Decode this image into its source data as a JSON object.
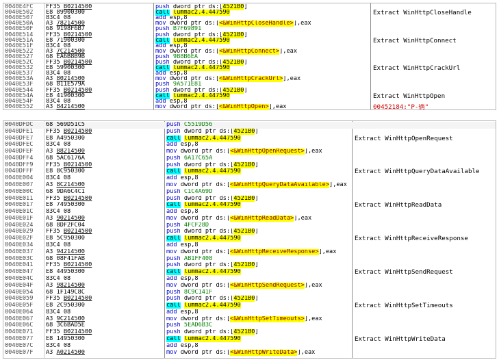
{
  "panel1": {
    "rows": [
      {
        "addr": "0040E4FC",
        "bytes": "FF35 B0214500",
        "bu": "B0214500",
        "mn": "push",
        "op": [
          {
            "t": "dword ptr ds:[",
            "c": "plain"
          },
          {
            "t": "4521B0",
            "c": "tgt"
          },
          {
            "t": "]",
            "c": "plain"
          }
        ]
      },
      {
        "addr": "0040E502",
        "bytes": "E8 89900300",
        "mn": "call",
        "op": [
          {
            "t": "lummac2.4.447590",
            "c": "tgt"
          }
        ],
        "call": true,
        "cmt": "Extract WinHttpCloseHandle"
      },
      {
        "addr": "0040E507",
        "bytes": "83C4 08",
        "mn": "add",
        "op": [
          {
            "t": "esp,8",
            "c": "plain"
          }
        ]
      },
      {
        "addr": "0040E50A",
        "bytes": "A3 78214500",
        "bu": "78214500",
        "mn": "mov",
        "op": [
          {
            "t": "dword ptr ds:[",
            "c": "plain"
          },
          {
            "t": "<&WinHttpCloseHandle>",
            "c": "imp"
          },
          {
            "t": "],eax",
            "c": "plain"
          }
        ]
      },
      {
        "addr": "0040E50F",
        "bytes": "68 9198F6B7",
        "mn": "push",
        "op": [
          {
            "t": "B7F69891",
            "c": "num"
          }
        ]
      },
      {
        "addr": "0040E514",
        "bytes": "FF35 B0214500",
        "bu": "B0214500",
        "mn": "push",
        "op": [
          {
            "t": "dword ptr ds:[",
            "c": "plain"
          },
          {
            "t": "4521B0",
            "c": "tgt"
          },
          {
            "t": "]",
            "c": "plain"
          }
        ]
      },
      {
        "addr": "0040E51A",
        "bytes": "E8 71900300",
        "mn": "call",
        "op": [
          {
            "t": "lummac2.4.447590",
            "c": "tgt"
          }
        ],
        "call": true,
        "cmt": "Extract WinHttpConnect"
      },
      {
        "addr": "0040E51F",
        "bytes": "83C4 08",
        "mn": "add",
        "op": [
          {
            "t": "esp,8",
            "c": "plain"
          }
        ]
      },
      {
        "addr": "0040E522",
        "bytes": "A3 7C214500",
        "bu": "7C214500",
        "mn": "mov",
        "op": [
          {
            "t": "dword ptr ds:[",
            "c": "plain"
          },
          {
            "t": "<&WinHttpConnect>",
            "c": "imp"
          },
          {
            "t": "],eax",
            "c": "plain"
          }
        ]
      },
      {
        "addr": "0040E527",
        "bytes": "68 EA6B8B9B",
        "mn": "push",
        "op": [
          {
            "t": "9B8B6EA",
            "c": "num"
          }
        ]
      },
      {
        "addr": "0040E52C",
        "bytes": "FF35 B0214500",
        "bu": "B0214500",
        "mn": "push",
        "op": [
          {
            "t": "dword ptr ds:[",
            "c": "plain"
          },
          {
            "t": "4521B0",
            "c": "tgt"
          },
          {
            "t": "]",
            "c": "plain"
          }
        ]
      },
      {
        "addr": "0040E532",
        "bytes": "E8 59900300",
        "mn": "call",
        "op": [
          {
            "t": "lummac2.4.447590",
            "c": "tgt"
          }
        ],
        "call": true,
        "cmt": "Extract WinHttpCrackUrl"
      },
      {
        "addr": "0040E537",
        "bytes": "83C4 08",
        "mn": "add",
        "op": [
          {
            "t": "esp,8",
            "c": "plain"
          }
        ]
      },
      {
        "addr": "0040E53A",
        "bytes": "A3 80214500",
        "bu": "80214500",
        "mn": "mov",
        "op": [
          {
            "t": "dword ptr ds:[",
            "c": "plain"
          },
          {
            "t": "<&WinHttpCrackUrl>",
            "c": "imp"
          },
          {
            "t": "],eax",
            "c": "plain"
          }
        ]
      },
      {
        "addr": "0040E53F",
        "bytes": "68 811E579A",
        "mn": "push",
        "op": [
          {
            "t": "9A571E81",
            "c": "num"
          }
        ]
      },
      {
        "addr": "0040E544",
        "bytes": "FF35 B0214500",
        "bu": "B0214500",
        "mn": "push",
        "op": [
          {
            "t": "dword ptr ds:[",
            "c": "plain"
          },
          {
            "t": "4521B0",
            "c": "tgt"
          },
          {
            "t": "]",
            "c": "plain"
          }
        ]
      },
      {
        "addr": "0040E54A",
        "bytes": "E8 41900300",
        "mn": "call",
        "op": [
          {
            "t": "lummac2.4.447590",
            "c": "tgt"
          }
        ],
        "call": true,
        "cmt": "Extract WinHttpOpen"
      },
      {
        "addr": "0040E54F",
        "bytes": "83C4 08",
        "mn": "add",
        "op": [
          {
            "t": "esp,8",
            "c": "plain"
          }
        ]
      },
      {
        "addr": "0040E552",
        "bytes": "A3 84214500",
        "bu": "84214500",
        "mn": "mov",
        "op": [
          {
            "t": "dword ptr ds:[",
            "c": "plain"
          },
          {
            "t": "<&WinHttpOpen>",
            "c": "imp"
          },
          {
            "t": "],eax",
            "c": "plain"
          }
        ],
        "cmt": "00452184:\"P-徜\"",
        "cmtRed": true
      }
    ]
  },
  "panel2": {
    "rows": [
      {
        "addr": "0040DFDC",
        "bytes": "68 569D51C5",
        "mn": "push",
        "op": [
          {
            "t": "C5519D56",
            "c": "num"
          }
        ]
      },
      {
        "addr": "0040DFE1",
        "bytes": "FF35 B0214500",
        "bu": "B0214500",
        "mn": "push",
        "op": [
          {
            "t": "dword ptr ds:[",
            "c": "plain"
          },
          {
            "t": "4521B0",
            "c": "tgt"
          },
          {
            "t": "]",
            "c": "plain"
          }
        ]
      },
      {
        "addr": "0040DFE7",
        "bytes": "E8 A4950300",
        "mn": "call",
        "op": [
          {
            "t": "lummac2.4.447590",
            "c": "tgt"
          }
        ],
        "call": true,
        "cmt": "Extract WinHttpOpenRequest"
      },
      {
        "addr": "0040DFEC",
        "bytes": "83C4 08",
        "mn": "add",
        "op": [
          {
            "t": "esp,8",
            "c": "plain"
          }
        ]
      },
      {
        "addr": "0040DFEF",
        "bytes": "A3 88214500",
        "bu": "88214500",
        "mn": "mov",
        "op": [
          {
            "t": "dword ptr ds:[",
            "c": "plain"
          },
          {
            "t": "<&WinHttpOpenRequest>",
            "c": "imp"
          },
          {
            "t": "],eax",
            "c": "plain"
          }
        ]
      },
      {
        "addr": "0040DFF4",
        "bytes": "68 5AC6176A",
        "mn": "push",
        "op": [
          {
            "t": "6A17C65A",
            "c": "num"
          }
        ]
      },
      {
        "addr": "0040DFF9",
        "bytes": "FF35 B0214500",
        "bu": "B0214500",
        "mn": "push",
        "op": [
          {
            "t": "dword ptr ds:[",
            "c": "plain"
          },
          {
            "t": "4521B0",
            "c": "tgt"
          },
          {
            "t": "]",
            "c": "plain"
          }
        ]
      },
      {
        "addr": "0040DFFF",
        "bytes": "E8 8C950300",
        "mn": "call",
        "op": [
          {
            "t": "lummac2.4.447590",
            "c": "tgt"
          }
        ],
        "call": true,
        "cmt": "Extract WinHttpQueryDataAvailable"
      },
      {
        "addr": "0040E004",
        "bytes": "83C4 08",
        "mn": "add",
        "op": [
          {
            "t": "esp,8",
            "c": "plain"
          }
        ]
      },
      {
        "addr": "0040E007",
        "bytes": "A3 8C214500",
        "bu": "8C214500",
        "mn": "mov",
        "op": [
          {
            "t": "dword ptr ds:[",
            "c": "plain"
          },
          {
            "t": "<&WinHttpQueryDataAvailable>",
            "c": "imp"
          },
          {
            "t": "],eax",
            "c": "plain"
          }
        ]
      },
      {
        "addr": "0040E00C",
        "bytes": "68 9DA6C4C1",
        "mn": "push",
        "op": [
          {
            "t": "C1C4A69D",
            "c": "num"
          }
        ]
      },
      {
        "addr": "0040E011",
        "bytes": "FF35 B0214500",
        "bu": "B0214500",
        "mn": "push",
        "op": [
          {
            "t": "dword ptr ds:[",
            "c": "plain"
          },
          {
            "t": "4521B0",
            "c": "tgt"
          },
          {
            "t": "]",
            "c": "plain"
          }
        ]
      },
      {
        "addr": "0040E017",
        "bytes": "E8 74950300",
        "mn": "call",
        "op": [
          {
            "t": "lummac2.4.447590",
            "c": "tgt"
          }
        ],
        "call": true,
        "cmt": "Extract WinHttpReadData"
      },
      {
        "addr": "0040E01C",
        "bytes": "83C4 08",
        "mn": "add",
        "op": [
          {
            "t": "esp,8",
            "c": "plain"
          }
        ]
      },
      {
        "addr": "0040E01F",
        "bytes": "A3 90214500",
        "bu": "90214500",
        "mn": "mov",
        "op": [
          {
            "t": "dword ptr ds:[",
            "c": "plain"
          },
          {
            "t": "<&WinHttpReadData>",
            "c": "imp"
          },
          {
            "t": "],eax",
            "c": "plain"
          }
        ]
      },
      {
        "addr": "0040E024",
        "bytes": "68 8DF2FC04",
        "mn": "push",
        "op": [
          {
            "t": "4FCF28D",
            "c": "num"
          }
        ]
      },
      {
        "addr": "0040E029",
        "bytes": "FF35 B0214500",
        "bu": "B0214500",
        "mn": "push",
        "op": [
          {
            "t": "dword ptr ds:[",
            "c": "plain"
          },
          {
            "t": "4521B0",
            "c": "tgt"
          },
          {
            "t": "]",
            "c": "plain"
          }
        ]
      },
      {
        "addr": "0040E02F",
        "bytes": "E8 5C950300",
        "mn": "call",
        "op": [
          {
            "t": "lummac2.4.447590",
            "c": "tgt"
          }
        ],
        "call": true,
        "cmt": "Extract WinHttpReceiveResponse"
      },
      {
        "addr": "0040E034",
        "bytes": "83C4 08",
        "mn": "add",
        "op": [
          {
            "t": "esp,8",
            "c": "plain"
          }
        ]
      },
      {
        "addr": "0040E037",
        "bytes": "A3 94214500",
        "bu": "94214500",
        "mn": "mov",
        "op": [
          {
            "t": "dword ptr ds:[",
            "c": "plain"
          },
          {
            "t": "<&WinHttpReceiveResponse>",
            "c": "imp"
          },
          {
            "t": "],eax",
            "c": "plain"
          }
        ]
      },
      {
        "addr": "0040E03C",
        "bytes": "68 08F41FAB",
        "mn": "push",
        "op": [
          {
            "t": "AB1FF408",
            "c": "num"
          }
        ]
      },
      {
        "addr": "0040E041",
        "bytes": "FF35 B0214500",
        "bu": "B0214500",
        "mn": "push",
        "op": [
          {
            "t": "dword ptr ds:[",
            "c": "plain"
          },
          {
            "t": "4521B0",
            "c": "tgt"
          },
          {
            "t": "]",
            "c": "plain"
          }
        ]
      },
      {
        "addr": "0040E047",
        "bytes": "E8 44950300",
        "mn": "call",
        "op": [
          {
            "t": "lummac2.4.447590",
            "c": "tgt"
          }
        ],
        "call": true,
        "cmt": "Extract WinHttpSendRequest"
      },
      {
        "addr": "0040E04C",
        "bytes": "83C4 08",
        "mn": "add",
        "op": [
          {
            "t": "esp,8",
            "c": "plain"
          }
        ]
      },
      {
        "addr": "0040E04F",
        "bytes": "A3 98214500",
        "bu": "98214500",
        "mn": "mov",
        "op": [
          {
            "t": "dword ptr ds:[",
            "c": "plain"
          },
          {
            "t": "<&WinHttpSendRequest>",
            "c": "imp"
          },
          {
            "t": "],eax",
            "c": "plain"
          }
        ]
      },
      {
        "addr": "0040E054",
        "bytes": "68 1F149C8C",
        "mn": "push",
        "op": [
          {
            "t": "8C9C141F",
            "c": "num"
          }
        ]
      },
      {
        "addr": "0040E059",
        "bytes": "FF35 B0214500",
        "bu": "B0214500",
        "mn": "push",
        "op": [
          {
            "t": "dword ptr ds:[",
            "c": "plain"
          },
          {
            "t": "4521B0",
            "c": "tgt"
          },
          {
            "t": "]",
            "c": "plain"
          }
        ]
      },
      {
        "addr": "0040E05F",
        "bytes": "E8 2C950300",
        "mn": "call",
        "op": [
          {
            "t": "lummac2.4.447590",
            "c": "tgt"
          }
        ],
        "call": true,
        "cmt": "Extract WinHttpSetTimeouts"
      },
      {
        "addr": "0040E064",
        "bytes": "83C4 08",
        "mn": "add",
        "op": [
          {
            "t": "esp,8",
            "c": "plain"
          }
        ]
      },
      {
        "addr": "0040E067",
        "bytes": "A3 9C214500",
        "bu": "9C214500",
        "mn": "mov",
        "op": [
          {
            "t": "dword ptr ds:[",
            "c": "plain"
          },
          {
            "t": "<&WinHttpSetTimeouts>",
            "c": "imp"
          },
          {
            "t": "],eax",
            "c": "plain"
          }
        ]
      },
      {
        "addr": "0040E06C",
        "bytes": "68 3C6BAD5E",
        "mn": "push",
        "op": [
          {
            "t": "5EAD6B3C",
            "c": "num"
          }
        ]
      },
      {
        "addr": "0040E071",
        "bytes": "FF35 B0214500",
        "bu": "B0214500",
        "mn": "push",
        "op": [
          {
            "t": "dword ptr ds:[",
            "c": "plain"
          },
          {
            "t": "4521B0",
            "c": "tgt"
          },
          {
            "t": "]",
            "c": "plain"
          }
        ]
      },
      {
        "addr": "0040E077",
        "bytes": "E8 14950300",
        "mn": "call",
        "op": [
          {
            "t": "lummac2.4.447590",
            "c": "tgt"
          }
        ],
        "call": true,
        "cmt": "Extract WinHttpWriteData"
      },
      {
        "addr": "0040E07C",
        "bytes": "83C4 08",
        "mn": "add",
        "op": [
          {
            "t": "esp,8",
            "c": "plain"
          }
        ]
      },
      {
        "addr": "0040E07F",
        "bytes": "A3 A0214500",
        "bu": "A0214500",
        "mn": "mov",
        "op": [
          {
            "t": "dword ptr ds:[",
            "c": "plain"
          },
          {
            "t": "<&WinHttpWriteData>",
            "c": "imp"
          },
          {
            "t": "],eax",
            "c": "plain"
          }
        ]
      }
    ]
  }
}
